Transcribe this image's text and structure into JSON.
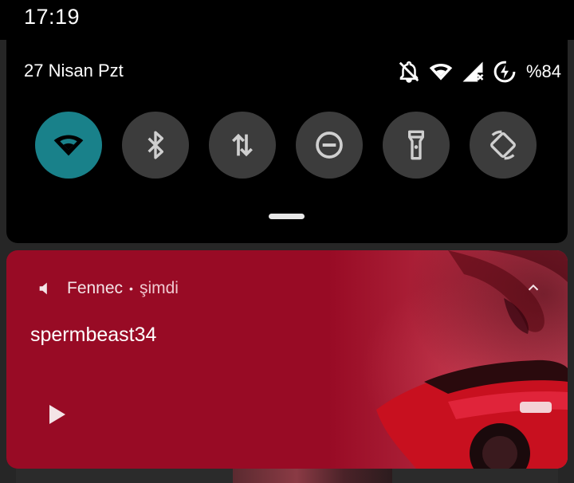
{
  "status_bar": {
    "time": "17:19"
  },
  "quick_settings": {
    "date": "27 Nisan Pzt",
    "battery": "%84",
    "status_icons": [
      "bell-off-icon",
      "wifi-icon",
      "cell-signal-no-data-icon",
      "battery-saver-icon"
    ],
    "tiles": [
      {
        "name": "wifi",
        "icon": "wifi-icon",
        "active": true
      },
      {
        "name": "bluetooth",
        "icon": "bluetooth-icon",
        "active": false
      },
      {
        "name": "mobile-data",
        "icon": "data-arrows-icon",
        "active": false
      },
      {
        "name": "do-not-disturb",
        "icon": "do-not-disturb-icon",
        "active": false
      },
      {
        "name": "flashlight",
        "icon": "flashlight-icon",
        "active": false
      },
      {
        "name": "auto-rotate",
        "icon": "rotate-icon",
        "active": false
      }
    ],
    "accent_color": "#19818a"
  },
  "media_notification": {
    "app_name": "Fennec",
    "separator": "•",
    "time": "şimdi",
    "title": "spermbeast34",
    "background_color": "#980b25"
  }
}
